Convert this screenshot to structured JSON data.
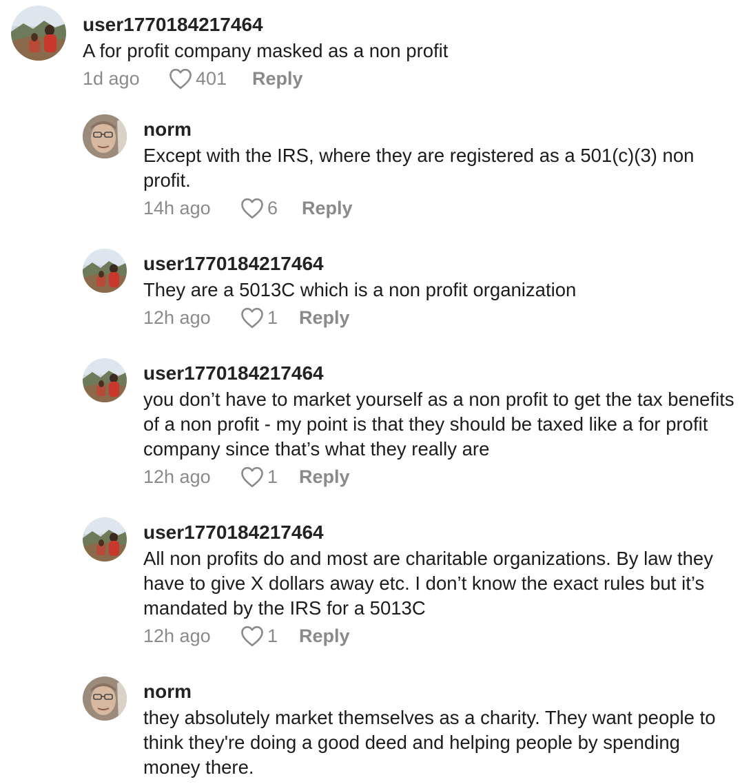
{
  "comments": [
    {
      "username": "user1770184217464",
      "avatar": "landscape-photo-avatar",
      "text": "A for profit company masked as a non profit",
      "time": "1d ago",
      "likes": "401",
      "reply_label": "Reply"
    },
    {
      "username": "norm",
      "avatar": "portrait-photo-avatar",
      "text": "Except with the IRS, where they are registered as a 501(c)(3) non profit.",
      "time": "14h ago",
      "likes": "6",
      "reply_label": "Reply"
    },
    {
      "username": "user1770184217464",
      "avatar": "landscape-photo-avatar",
      "text": "They are a 5013C which is a non profit organization",
      "time": "12h ago",
      "likes": "1",
      "reply_label": "Reply"
    },
    {
      "username": "user1770184217464",
      "avatar": "landscape-photo-avatar",
      "text": "you don’t have to market yourself as a non profit to get the tax benefits of a non profit - my point is that they should be taxed like a for profit company since that’s what they really are",
      "time": "12h ago",
      "likes": "1",
      "reply_label": "Reply"
    },
    {
      "username": "user1770184217464",
      "avatar": "landscape-photo-avatar",
      "text": "All non profits do and most are charitable organizations. By law they have to give X dollars away etc. I don’t know the exact rules but it’s mandated by the IRS for a 5013C",
      "time": "12h ago",
      "likes": "1",
      "reply_label": "Reply"
    },
    {
      "username": "norm",
      "avatar": "portrait-photo-avatar",
      "text": "they absolutely market themselves as a charity. They want people to think they're doing a good deed and helping people by spending money there."
    }
  ],
  "colors": {
    "username": "#222222",
    "text": "#1c1c1c",
    "meta": "#8a8a8a"
  }
}
